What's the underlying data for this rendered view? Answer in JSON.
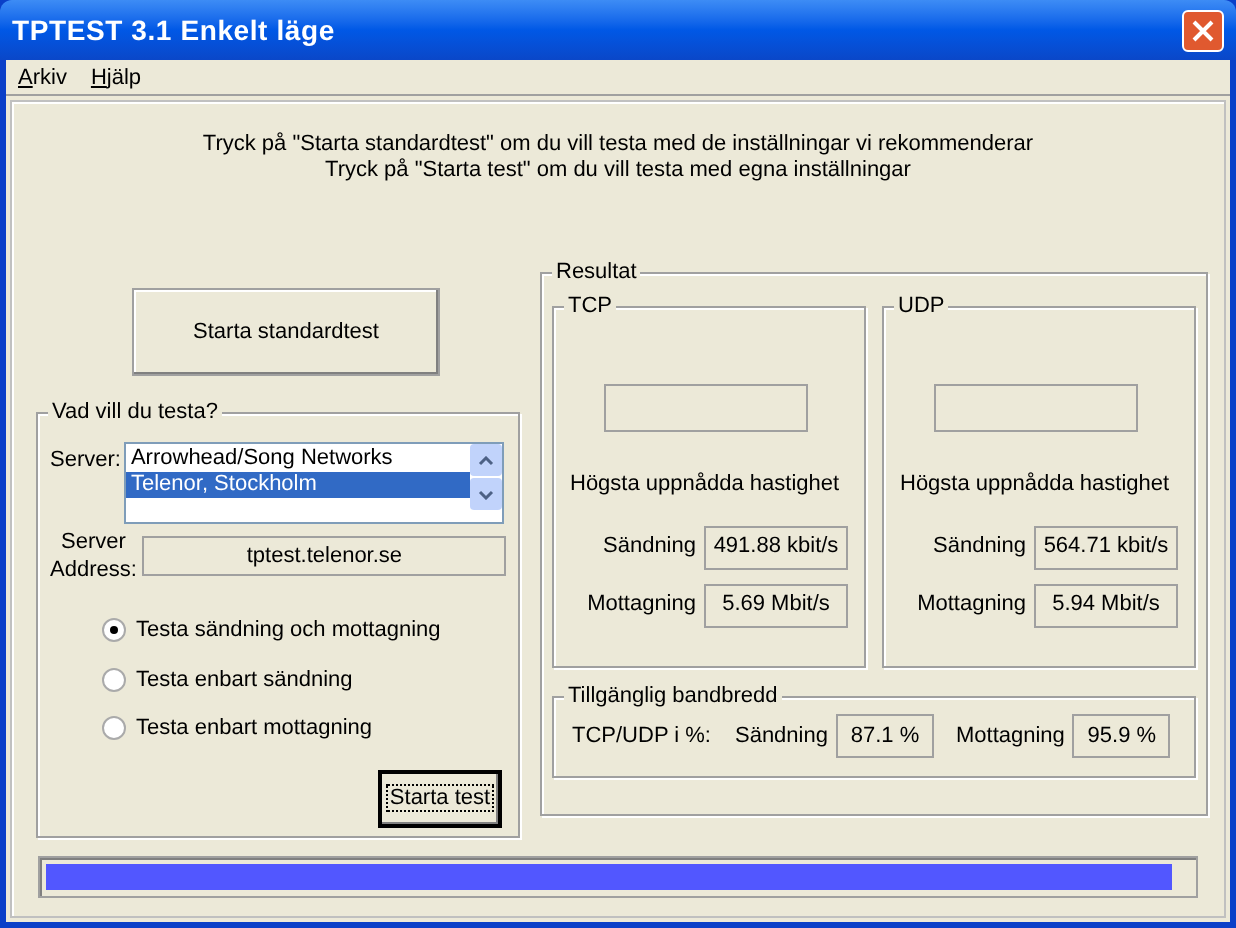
{
  "window": {
    "title": "TPTEST 3.1 Enkelt läge"
  },
  "menu": [
    {
      "label": "Arkiv"
    },
    {
      "label": "Hjälp"
    }
  ],
  "instructions": [
    "Tryck på \"Starta standardtest\" om du vill testa med de inställningar vi rekommenderar",
    "Tryck på \"Starta test\" om du vill testa med egna inställningar"
  ],
  "standard_button": "Starta standardtest",
  "test_group": {
    "title": "Vad vill du testa?",
    "server_label": "Server:",
    "servers": [
      {
        "label": "Arrowhead/Song Networks",
        "selected": false
      },
      {
        "label": "Telenor, Stockholm",
        "selected": true
      }
    ],
    "address_label": [
      "Server",
      "Address:"
    ],
    "address": "tptest.telenor.se",
    "options": [
      {
        "label": "Testa sändning och mottagning",
        "selected": true
      },
      {
        "label": "Testa enbart sändning",
        "selected": false
      },
      {
        "label": "Testa enbart mottagning",
        "selected": false
      }
    ],
    "start_button": "Starta test"
  },
  "results": {
    "title": "Resultat",
    "protocols": [
      {
        "title": "TCP",
        "caption": "Högsta uppnådda hastighet",
        "rows": [
          {
            "label": "Sändning",
            "value": "491.88 kbit/s"
          },
          {
            "label": "Mottagning",
            "value": "5.69 Mbit/s"
          }
        ]
      },
      {
        "title": "UDP",
        "caption": "Högsta uppnådda hastighet",
        "rows": [
          {
            "label": "Sändning",
            "value": "564.71 kbit/s"
          },
          {
            "label": "Mottagning",
            "value": "5.94 Mbit/s"
          }
        ]
      }
    ],
    "bandwidth": {
      "title": "Tillgänglig bandbredd",
      "label": "TCP/UDP i %:",
      "rows": [
        {
          "label": "Sändning",
          "value": "87.1 %"
        },
        {
          "label": "Mottagning",
          "value": "95.9 %"
        }
      ]
    }
  },
  "progress": {
    "level": 0.985
  }
}
